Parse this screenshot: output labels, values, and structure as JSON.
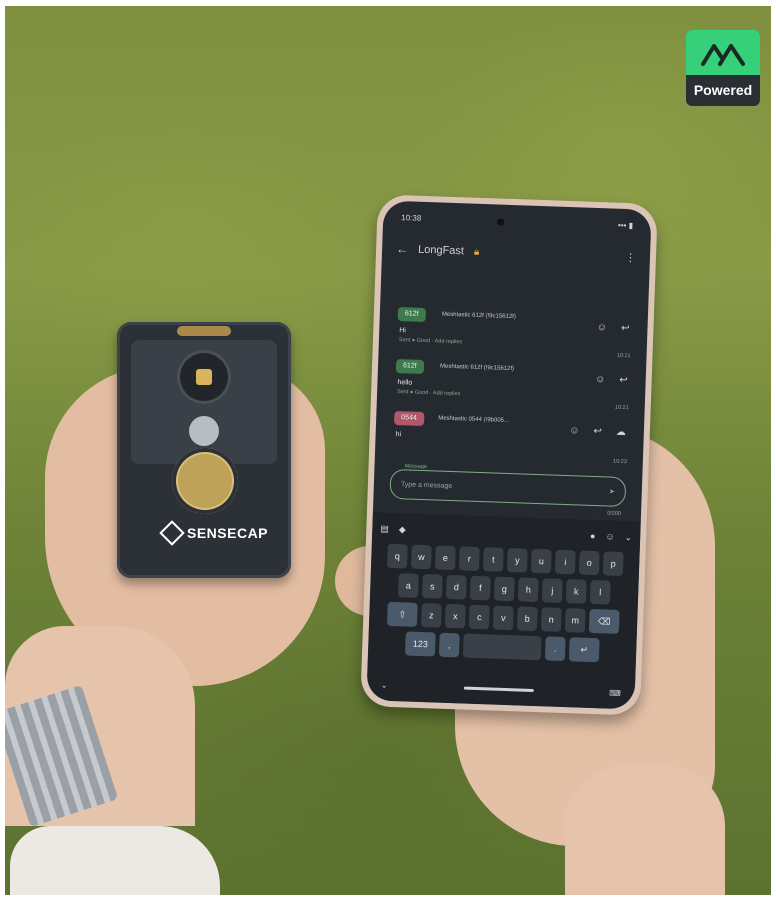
{
  "badge": {
    "label": "Powered"
  },
  "device": {
    "brand": "SENSECAP"
  },
  "phone": {
    "status_time": "10:38",
    "channel_title": "LongFast",
    "messages": [
      {
        "pill": "612f",
        "sender": "Meshtastic 612f (!9c15612f)",
        "text": "Hi",
        "status": "Sent ● Good · Add replies",
        "time": "10:21",
        "pill_color": "#3f7a4c"
      },
      {
        "pill": "612f",
        "sender": "Meshtastic 612f (!9c15612f)",
        "text": "hello",
        "status": "Sent ● Good · Add replies",
        "time": "10:21",
        "pill_color": "#3f7a4c"
      },
      {
        "pill": "0544",
        "sender": "Meshtastic 0544 (!9b005…",
        "text": "hi",
        "status": "",
        "time": "10:23",
        "pill_color": "#b2566b"
      }
    ],
    "input_label": "Message",
    "input_placeholder": "Type a message",
    "counter": "0/200",
    "keyboard": {
      "row1": [
        "q",
        "w",
        "e",
        "r",
        "t",
        "y",
        "u",
        "i",
        "o",
        "p"
      ],
      "row2": [
        "a",
        "s",
        "d",
        "f",
        "g",
        "h",
        "j",
        "k",
        "l"
      ],
      "row3": [
        "z",
        "x",
        "c",
        "v",
        "b",
        "n",
        "m"
      ],
      "num_key": "123",
      "comma": ",",
      "period": "."
    }
  }
}
